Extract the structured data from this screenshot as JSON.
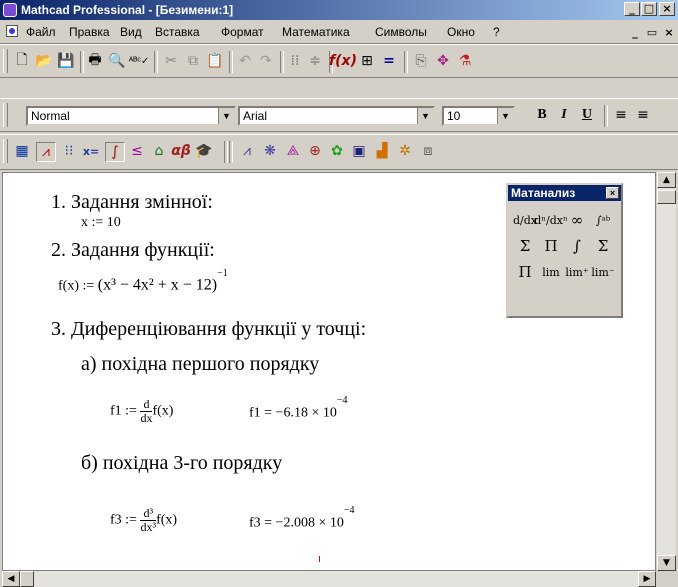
{
  "window": {
    "title": "Mathcad Professional - [Безимени:1]"
  },
  "menu": {
    "items": [
      "Файл",
      "Правка",
      "Вид",
      "Вставка",
      "Формат",
      "Математика",
      "Символы",
      "Окно",
      "?"
    ]
  },
  "format_bar": {
    "style": "Normal",
    "font": "Arial",
    "size": "10",
    "bold": "B",
    "italic": "I",
    "underline": "U"
  },
  "document": {
    "s1": "1. Задання змінної:",
    "x_def": "x := 10",
    "s2": "2. Задання функції:",
    "f_lhs": "f(x) := ",
    "f_body": "(x³ − 4x² + x − 12)",
    "f_exp": "−1",
    "s3": "3. Диференціювання функції у точці:",
    "s3a": "а) похідна першого порядку",
    "f1_lhs": "f1 := ",
    "d1_num": "d",
    "d1_den": "dx",
    "f1_expr": "f(x)",
    "f1_result": "f1 = −6.18 × 10",
    "f1_exp": "−4",
    "s3b": "б) похідна 3-го порядку",
    "f3_lhs": "f3 := ",
    "d3_num": "d³",
    "d3_den": "dx³",
    "f3_expr": "f(x)",
    "f3_result": "f3 = −2.008 × 10",
    "f3_exp": "−4"
  },
  "palette": {
    "title": "Матанализ",
    "close": "×",
    "symbols": [
      "d/dx",
      "dⁿ/dxⁿ",
      "∞",
      "∫ᵃᵇ",
      "Σ",
      "Π",
      "∫",
      "Σ",
      "Π",
      "lim",
      "lim⁺",
      "lim⁻"
    ]
  },
  "colors": {
    "titlebar": "#0a246a",
    "chrome": "#d4d0c8",
    "marker": "#e00000"
  }
}
